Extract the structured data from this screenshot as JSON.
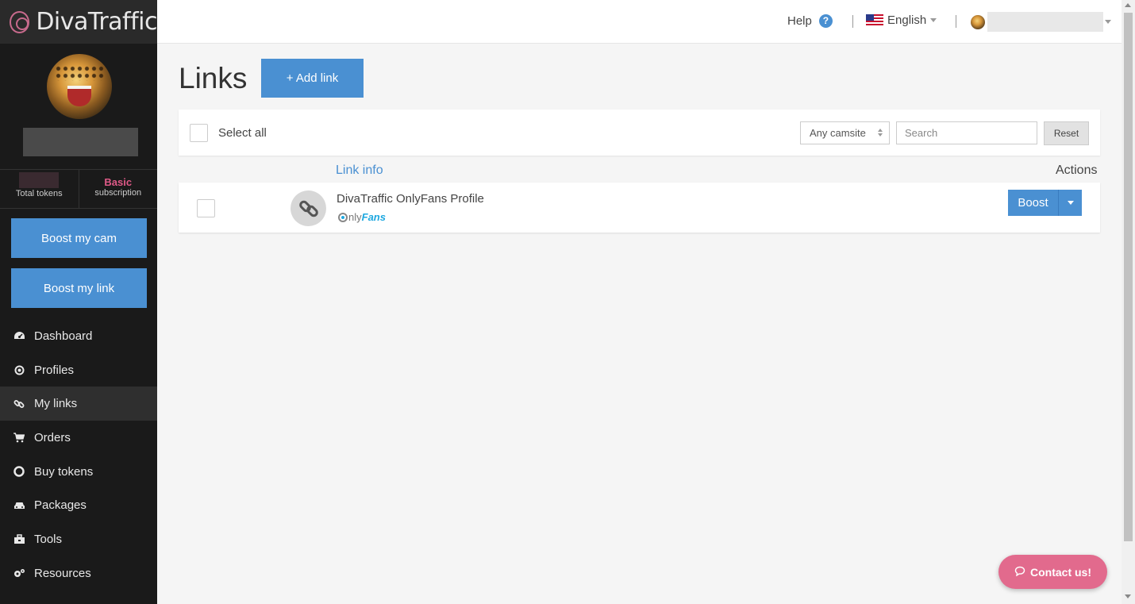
{
  "brand": {
    "name": "DivaTraffic"
  },
  "sidebar": {
    "stats": {
      "tokens_label": "Total tokens",
      "subscription_value": "Basic",
      "subscription_label": "subscription"
    },
    "boost_cam_label": "Boost my cam",
    "boost_link_label": "Boost my link",
    "nav": [
      {
        "label": "Dashboard",
        "icon": "dashboard-icon"
      },
      {
        "label": "Profiles",
        "icon": "target-icon"
      },
      {
        "label": "My links",
        "icon": "link-icon",
        "active": true
      },
      {
        "label": "Orders",
        "icon": "cart-icon"
      },
      {
        "label": "Buy tokens",
        "icon": "lifebuoy-icon"
      },
      {
        "label": "Packages",
        "icon": "car-icon"
      },
      {
        "label": "Tools",
        "icon": "toolbox-icon"
      },
      {
        "label": "Resources",
        "icon": "cogs-icon"
      }
    ]
  },
  "topbar": {
    "help_label": "Help",
    "language": "English"
  },
  "main": {
    "title": "Links",
    "add_link_label": "+ Add link",
    "filter": {
      "select_all_label": "Select all",
      "camsite_value": "Any camsite",
      "search_placeholder": "Search",
      "reset_label": "Reset"
    },
    "columns": {
      "link_info": "Link info",
      "actions": "Actions"
    },
    "links": [
      {
        "name": "DivaTraffic OnlyFans Profile",
        "site_logo_nly": "nly",
        "site_logo_fans": "Fans",
        "action_label": "Boost"
      }
    ]
  },
  "contact_label": "Contact us!",
  "colors": {
    "accent": "#4a90d2",
    "brand_pink": "#e26a8d",
    "sidebar_bg": "#1a1a1a"
  }
}
